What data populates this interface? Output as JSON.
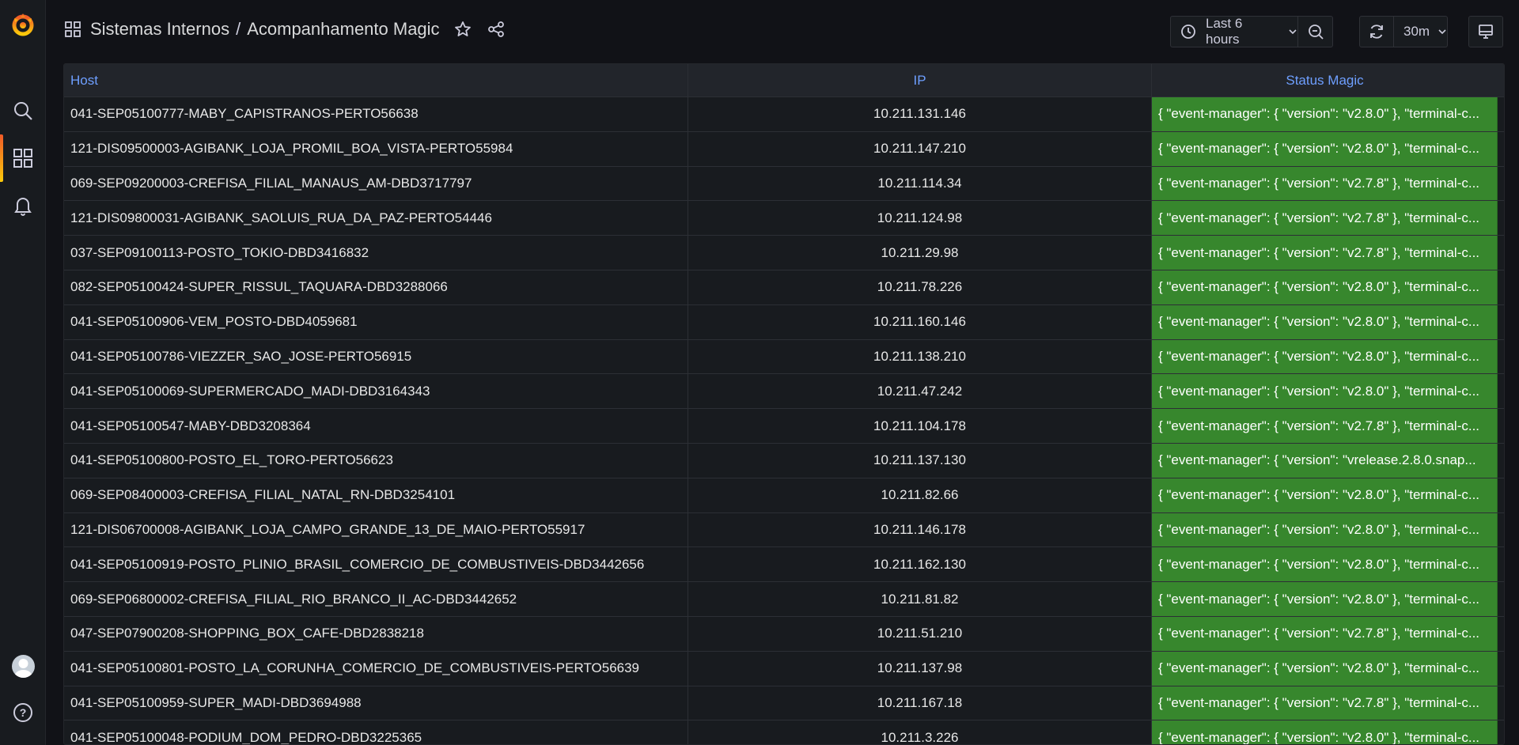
{
  "breadcrumb": {
    "folder": "Sistemas Internos",
    "separator": "/",
    "dashboard": "Acompanhamento Magic"
  },
  "toolbar": {
    "time_range": "Last 6 hours",
    "refresh_interval": "30m"
  },
  "table": {
    "headers": {
      "host": "Host",
      "ip": "IP",
      "status": "Status Magic"
    },
    "rows": [
      {
        "host": "041-SEP05100777-MABY_CAPISTRANOS-PERTO56638",
        "ip": "10.211.131.146",
        "status": "{ \"event-manager\": { \"version\": \"v2.8.0\" }, \"terminal-c..."
      },
      {
        "host": "121-DIS09500003-AGIBANK_LOJA_PROMIL_BOA_VISTA-PERTO55984",
        "ip": "10.211.147.210",
        "status": "{ \"event-manager\": { \"version\": \"v2.8.0\" }, \"terminal-c..."
      },
      {
        "host": "069-SEP09200003-CREFISA_FILIAL_MANAUS_AM-DBD3717797",
        "ip": "10.211.114.34",
        "status": "{ \"event-manager\": { \"version\": \"v2.7.8\" }, \"terminal-c..."
      },
      {
        "host": "121-DIS09800031-AGIBANK_SAOLUIS_RUA_DA_PAZ-PERTO54446",
        "ip": "10.211.124.98",
        "status": "{ \"event-manager\": { \"version\": \"v2.7.8\" }, \"terminal-c..."
      },
      {
        "host": "037-SEP09100113-POSTO_TOKIO-DBD3416832",
        "ip": "10.211.29.98",
        "status": "{ \"event-manager\": { \"version\": \"v2.7.8\" }, \"terminal-c..."
      },
      {
        "host": "082-SEP05100424-SUPER_RISSUL_TAQUARA-DBD3288066",
        "ip": "10.211.78.226",
        "status": "{ \"event-manager\": { \"version\": \"v2.8.0\" }, \"terminal-c..."
      },
      {
        "host": "041-SEP05100906-VEM_POSTO-DBD4059681",
        "ip": "10.211.160.146",
        "status": "{ \"event-manager\": { \"version\": \"v2.8.0\" }, \"terminal-c..."
      },
      {
        "host": "041-SEP05100786-VIEZZER_SAO_JOSE-PERTO56915",
        "ip": "10.211.138.210",
        "status": "{ \"event-manager\": { \"version\": \"v2.8.0\" }, \"terminal-c..."
      },
      {
        "host": "041-SEP05100069-SUPERMERCADO_MADI-DBD3164343",
        "ip": "10.211.47.242",
        "status": "{ \"event-manager\": { \"version\": \"v2.8.0\" }, \"terminal-c..."
      },
      {
        "host": "041-SEP05100547-MABY-DBD3208364",
        "ip": "10.211.104.178",
        "status": "{ \"event-manager\": { \"version\": \"v2.7.8\" }, \"terminal-c..."
      },
      {
        "host": "041-SEP05100800-POSTO_EL_TORO-PERTO56623",
        "ip": "10.211.137.130",
        "status": "{ \"event-manager\": { \"version\": \"vrelease.2.8.0.snap..."
      },
      {
        "host": "069-SEP08400003-CREFISA_FILIAL_NATAL_RN-DBD3254101",
        "ip": "10.211.82.66",
        "status": "{ \"event-manager\": { \"version\": \"v2.8.0\" }, \"terminal-c..."
      },
      {
        "host": "121-DIS06700008-AGIBANK_LOJA_CAMPO_GRANDE_13_DE_MAIO-PERTO55917",
        "ip": "10.211.146.178",
        "status": "{ \"event-manager\": { \"version\": \"v2.8.0\" }, \"terminal-c..."
      },
      {
        "host": "041-SEP05100919-POSTO_PLINIO_BRASIL_COMERCIO_DE_COMBUSTIVEIS-DBD3442656",
        "ip": "10.211.162.130",
        "status": "{ \"event-manager\": { \"version\": \"v2.8.0\" }, \"terminal-c..."
      },
      {
        "host": "069-SEP06800002-CREFISA_FILIAL_RIO_BRANCO_II_AC-DBD3442652",
        "ip": "10.211.81.82",
        "status": "{ \"event-manager\": { \"version\": \"v2.8.0\" }, \"terminal-c..."
      },
      {
        "host": "047-SEP07900208-SHOPPING_BOX_CAFE-DBD2838218",
        "ip": "10.211.51.210",
        "status": "{ \"event-manager\": { \"version\": \"v2.7.8\" }, \"terminal-c..."
      },
      {
        "host": "041-SEP05100801-POSTO_LA_CORUNHA_COMERCIO_DE_COMBUSTIVEIS-PERTO56639",
        "ip": "10.211.137.98",
        "status": "{ \"event-manager\": { \"version\": \"v2.8.0\" }, \"terminal-c..."
      },
      {
        "host": "041-SEP05100959-SUPER_MADI-DBD3694988",
        "ip": "10.211.167.18",
        "status": "{ \"event-manager\": { \"version\": \"v2.7.8\" }, \"terminal-c..."
      },
      {
        "host": "041-SEP05100048-PODIUM_DOM_PEDRO-DBD3225365",
        "ip": "10.211.3.226",
        "status": "{ \"event-manager\": { \"version\": \"v2.8.0\" }, \"terminal-c..."
      }
    ]
  },
  "colors": {
    "status_ok": "#37872d",
    "header_link": "#6e9fff",
    "background": "#111217"
  },
  "icons": {
    "logo": "grafana-logo",
    "search": "search-icon",
    "dashboards": "dashboards-icon",
    "alerting": "bell-icon",
    "help": "help-icon"
  }
}
